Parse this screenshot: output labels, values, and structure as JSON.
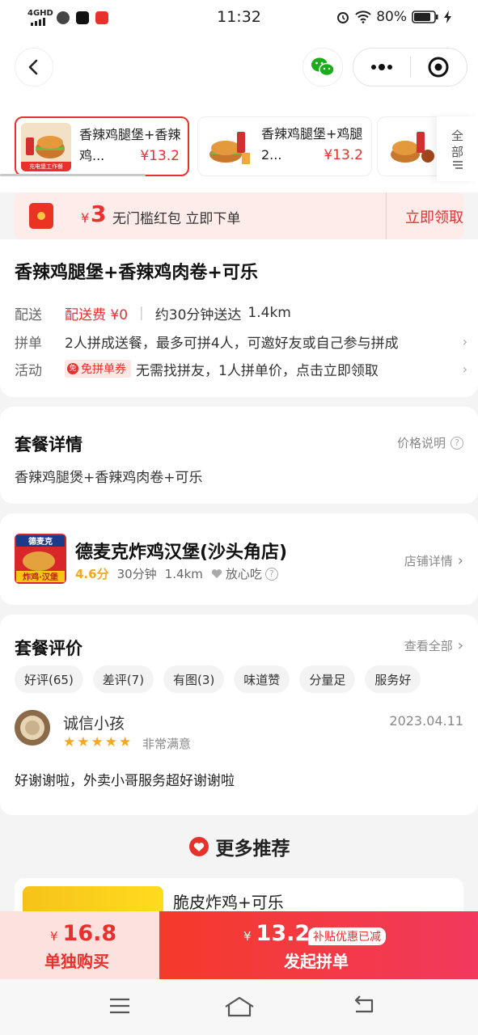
{
  "status_bar": {
    "network": "4GHD",
    "time": "11:32",
    "battery": "80%"
  },
  "nav": {
    "icons": [
      "back-icon",
      "wechat-icon",
      "more-icon",
      "target-icon"
    ]
  },
  "packages": [
    {
      "name": "香辣鸡腿堡+香辣鸡...",
      "price": "¥13.2",
      "tag": "充电堡工作餐",
      "selected": true
    },
    {
      "name": "香辣鸡腿堡+鸡腿2...",
      "price": "¥13.2",
      "selected": false
    }
  ],
  "all_button": {
    "chars": [
      "全",
      "部"
    ]
  },
  "coupon": {
    "yen": "¥",
    "amount": "3",
    "text": "无门槛红包 立即下单",
    "claim": "立即领取"
  },
  "product": {
    "title": "香辣鸡腿堡+香辣鸡肉卷+可乐",
    "delivery_label": "配送",
    "delivery_fee": "配送费 ¥0",
    "delivery_time": "约30分钟送达",
    "delivery_distance": "1.4km",
    "group_label": "拼单",
    "group_text": "2人拼成送餐，最多可拼4人，可邀好友或自己参与拼成",
    "activity_label": "活动",
    "activity_tag": "免拼单券",
    "activity_tag_icon": "免",
    "activity_text": "无需找拼友，1人拼单价，点击立即领取"
  },
  "details": {
    "title": "套餐详情",
    "link": "价格说明",
    "qmark": "?",
    "content": "香辣鸡腿煲+香辣鸡肉卷+可乐"
  },
  "shop": {
    "name": "德麦克炸鸡汉堡(沙头角店)",
    "score": "4.6分",
    "time": "30分钟",
    "distance": "1.4km",
    "safe": "放心吃",
    "link": "店铺详情",
    "logo_top": "德麦克",
    "logo_bottom": "炸鸡·汉堡"
  },
  "reviews": {
    "title": "套餐评价",
    "link": "查看全部",
    "chips": [
      "好评(65)",
      "差评(7)",
      "有图(3)",
      "味道赞",
      "分量足",
      "服务好"
    ],
    "item": {
      "user": "诚信小孩",
      "date": "2023.04.11",
      "stars": 5,
      "rating_text": "非常满意",
      "text": "好谢谢啦，外卖小哥服务超好谢谢啦"
    }
  },
  "more": {
    "title": "更多推荐",
    "first_item": "脆皮炸鸡+可乐"
  },
  "bottom": {
    "single_yen": "¥",
    "single_price": "16.8",
    "single_label": "单独购买",
    "group_yen": "¥",
    "group_price": "13.2",
    "group_label": "发起拼单",
    "subsidy": "补贴优惠已减"
  },
  "colors": {
    "accent": "#e8302c",
    "star": "#f5a623"
  }
}
